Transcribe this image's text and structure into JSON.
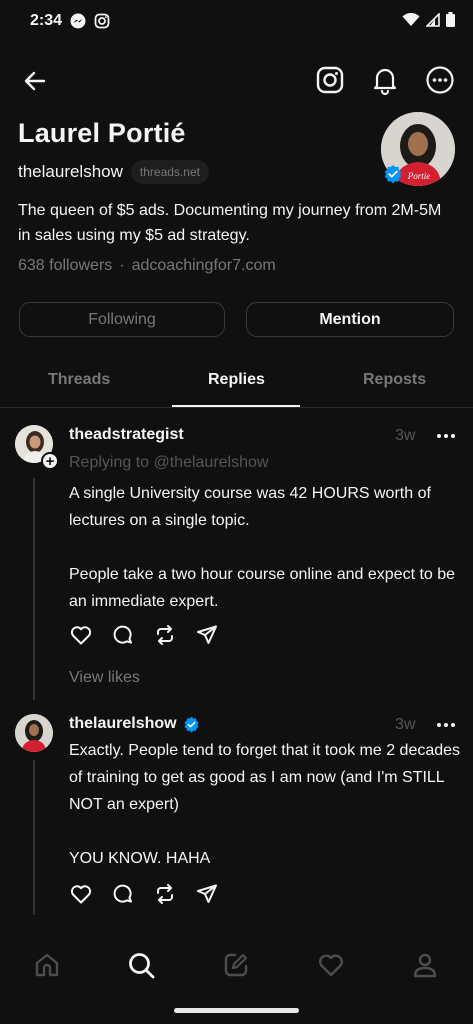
{
  "status_bar": {
    "time": "2:34"
  },
  "profile": {
    "name": "Laurel Portié",
    "handle": "thelaurelshow",
    "domain_badge": "threads.net",
    "bio": "The queen of $5 ads. Documenting my journey from 2M-5M in sales using my $5 ad strategy.",
    "followers": "638 followers",
    "separator": "·",
    "link": "adcoachingfor7.com",
    "shirt_text": "Portie"
  },
  "buttons": {
    "following": "Following",
    "mention": "Mention"
  },
  "tabs": {
    "threads": "Threads",
    "replies": "Replies",
    "reposts": "Reposts"
  },
  "posts": [
    {
      "username": "theadstrategist",
      "time": "3w",
      "replying_to": "Replying to @thelaurelshow",
      "paragraphs": [
        "A single University course was 42 HOURS worth of lectures on a single topic.",
        "People take a two hour course online and expect to be an immediate expert."
      ],
      "view_likes": "View likes"
    },
    {
      "username": "thelaurelshow",
      "time": "3w",
      "paragraphs": [
        "Exactly. People tend to forget that it took me 2 decades of training to get as good as I am now (and I'm STILL NOT an expert)",
        "YOU KNOW. HAHA"
      ]
    }
  ],
  "colors": {
    "background": "#101010",
    "text": "#f3f5f7",
    "muted": "#777777",
    "verified": "#0095f6",
    "shirt": "#d32030"
  }
}
